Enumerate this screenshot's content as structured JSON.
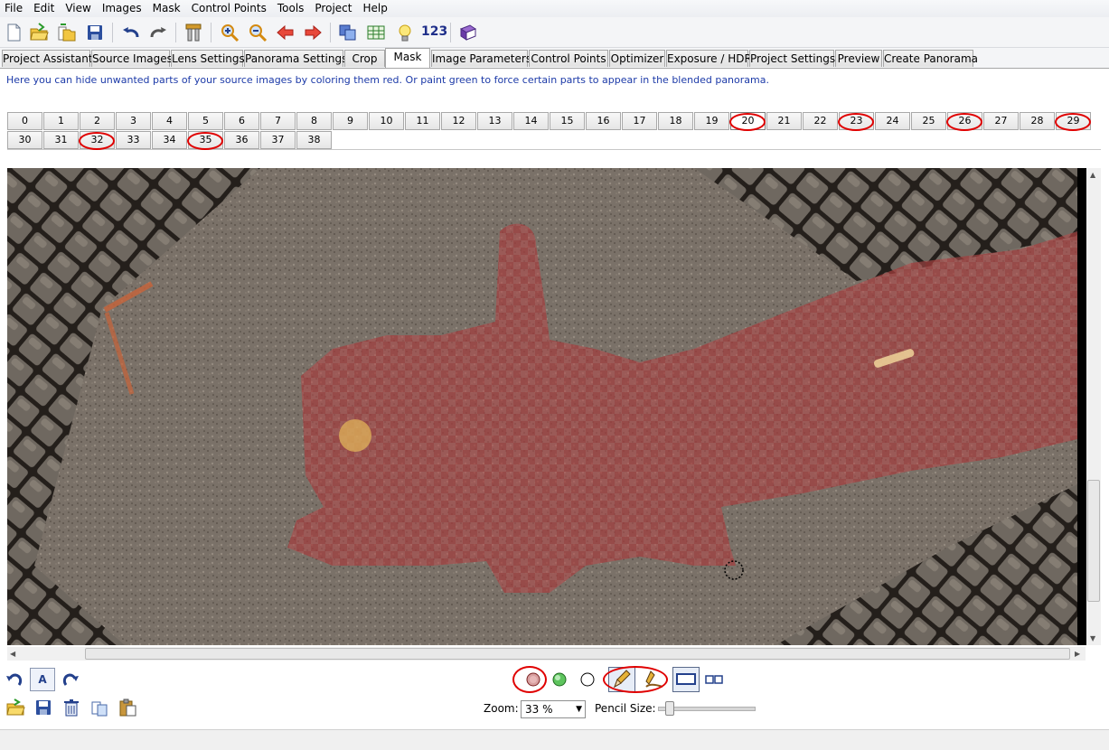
{
  "menu": [
    "File",
    "Edit",
    "View",
    "Images",
    "Mask",
    "Control Points",
    "Tools",
    "Project",
    "Help"
  ],
  "toolbar": {
    "buttons": [
      "new-icon",
      "open-icon",
      "open-folder-icon",
      "save-icon",
      "undo-icon",
      "redo-icon",
      "tools-icon",
      "zoom-in-icon",
      "zoom-out-icon",
      "previous-arrow-icon",
      "next-arrow-icon",
      "preview-icon",
      "spreadsheet-icon",
      "lightbulb-icon"
    ],
    "number_label": "123",
    "last_button": "book-icon"
  },
  "tabs": [
    "Project Assistant",
    "Source Images",
    "Lens Settings",
    "Panorama Settings",
    "Crop",
    "Mask",
    "Image Parameters",
    "Control Points",
    "Optimizer",
    "Exposure / HDR",
    "Project Settings",
    "Preview",
    "Create Panorama"
  ],
  "active_tab": "Mask",
  "info_text": "Here you can hide unwanted parts of your source images by coloring them red. Or paint green to force certain parts to appear in the blended panorama.",
  "image_numbers": [
    "0",
    "1",
    "2",
    "3",
    "4",
    "5",
    "6",
    "7",
    "8",
    "9",
    "10",
    "11",
    "12",
    "13",
    "14",
    "15",
    "16",
    "17",
    "18",
    "19",
    "20",
    "21",
    "22",
    "23",
    "24",
    "25",
    "26",
    "27",
    "28",
    "29",
    "30",
    "31",
    "32",
    "33",
    "34",
    "35",
    "36",
    "37",
    "38"
  ],
  "selected_image": "20",
  "highlighted_images": [
    "20",
    "23",
    "26",
    "29",
    "32",
    "35"
  ],
  "bottom_toolbar": {
    "left_row1": [
      "rotate-left-icon",
      "auto-icon",
      "rotate-right-icon"
    ],
    "auto_label": "A",
    "left_row2": [
      "load-mask-icon",
      "save-mask-icon",
      "delete-mask-icon",
      "copy-mask-icon",
      "paste-mask-icon"
    ],
    "color_modes": [
      "red-exclude",
      "green-include",
      "erase"
    ],
    "tools": [
      "pencil-icon",
      "brush-icon"
    ],
    "view_modes": [
      "single-view-icon",
      "dual-view-icon"
    ]
  },
  "zoom": {
    "label": "Zoom:",
    "value": "33 %"
  },
  "pencil": {
    "label": "Pencil Size:",
    "level": 0.08
  },
  "colors": {
    "mask_red": "#c0393a",
    "annotation_red": "#e00000",
    "info_text": "#1c3aa8"
  }
}
